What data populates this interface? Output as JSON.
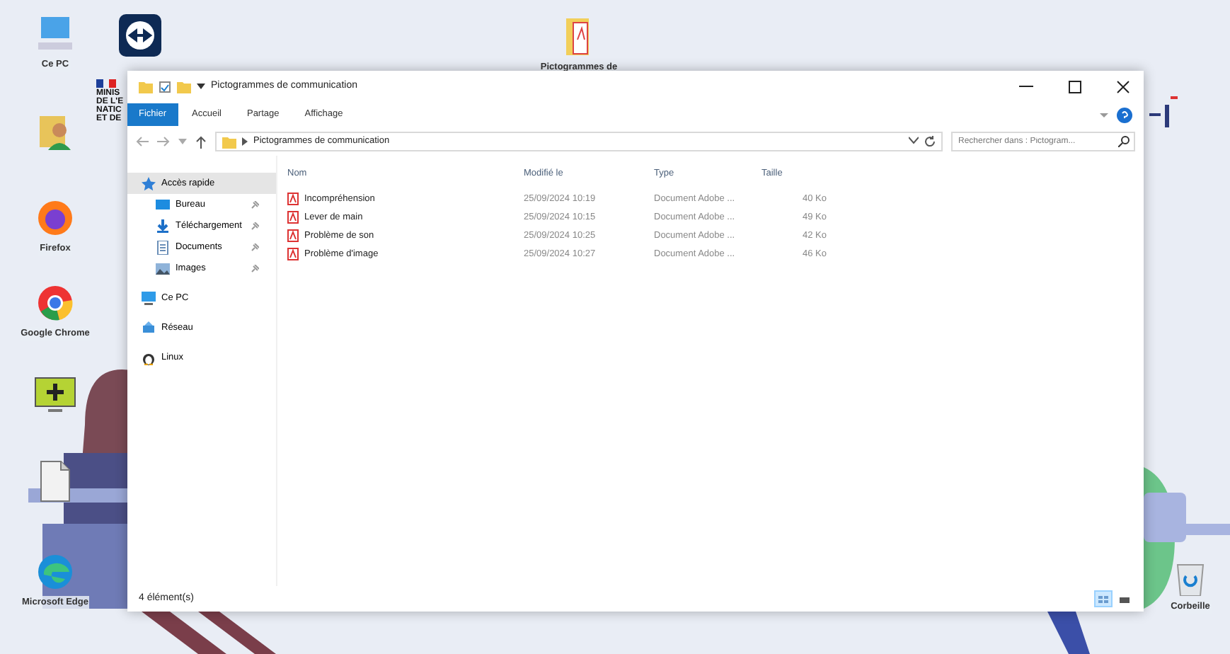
{
  "desktop_icons": [
    {
      "kind": "pc",
      "label": "Ce PC"
    },
    {
      "kind": "remote"
    },
    {
      "kind": "user-folder"
    },
    {
      "kind": "firefox",
      "label": "Firefox"
    },
    {
      "kind": "chrome",
      "label": "Google Chrome"
    },
    {
      "kind": "monitor-plus"
    },
    {
      "kind": "document"
    },
    {
      "kind": "edge",
      "label": "Microsoft Edge"
    },
    {
      "kind": "pdf-folder",
      "label": "Pictogrammes de"
    },
    {
      "kind": "recycle",
      "label": "Corbeille"
    }
  ],
  "logo_lines": [
    "MINIS",
    "DE L'E",
    "NATIC",
    "ET DE"
  ],
  "window": {
    "title": "Pictogrammes de communication",
    "ribbon_tabs": [
      {
        "label": "Fichier",
        "kind": "file"
      },
      {
        "label": "Accueil",
        "kind": "tab"
      },
      {
        "label": "Partage",
        "kind": "tab"
      },
      {
        "label": "Affichage",
        "kind": "tab"
      }
    ],
    "address": {
      "path": "Pictogrammes de communication"
    },
    "search": {
      "placeholder": "Rechercher dans : Pictogram..."
    },
    "nav": [
      {
        "label": "Accès rapide",
        "kind": "star",
        "selected": true,
        "children": [
          {
            "label": "Bureau",
            "kind": "desktop",
            "selected": false
          },
          {
            "label": "Téléchargement",
            "kind": "download",
            "selected": false
          },
          {
            "label": "Documents",
            "kind": "docs",
            "selected": false
          },
          {
            "label": "Images",
            "kind": "images",
            "selected": false
          }
        ]
      },
      {
        "label": "Ce PC",
        "kind": "pc",
        "selected": false
      },
      {
        "label": "Réseau",
        "kind": "network",
        "selected": false
      },
      {
        "label": "Linux",
        "kind": "linux",
        "selected": false
      }
    ],
    "columns": [
      "Nom",
      "Modifié le",
      "Type",
      "Taille"
    ],
    "rows": [
      {
        "name": "Incompréhension",
        "modified": "25/09/2024 10:19",
        "type": "Document Adobe ...",
        "size": "40 Ko"
      },
      {
        "name": "Lever de main",
        "modified": "25/09/2024 10:15",
        "type": "Document Adobe ...",
        "size": "49 Ko"
      },
      {
        "name": "Problème de son",
        "modified": "25/09/2024 10:25",
        "type": "Document Adobe ...",
        "size": "42 Ko"
      },
      {
        "name": "Problème d'image",
        "modified": "25/09/2024 10:27",
        "type": "Document Adobe ...",
        "size": "46 Ko"
      }
    ],
    "status_bar": "4 élément(s)",
    "view_buttons": [
      {
        "kind": "details",
        "selected": true
      },
      {
        "kind": "tiles",
        "selected": false
      }
    ]
  }
}
